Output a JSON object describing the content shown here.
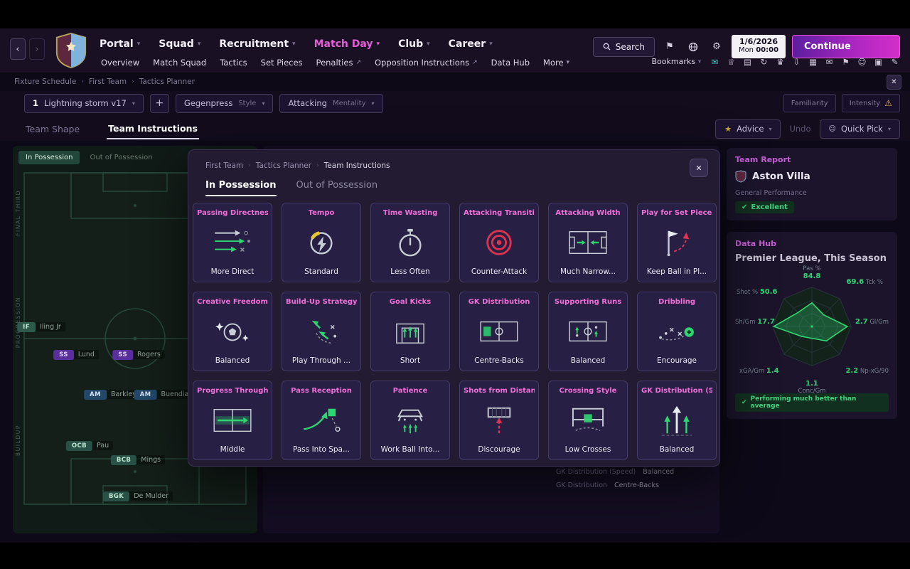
{
  "header": {
    "menus": [
      {
        "label": "Portal",
        "active": false
      },
      {
        "label": "Squad",
        "active": false
      },
      {
        "label": "Recruitment",
        "active": false
      },
      {
        "label": "Match Day",
        "active": true
      },
      {
        "label": "Club",
        "active": false
      },
      {
        "label": "Career",
        "active": false
      }
    ],
    "search_label": "Search",
    "date": "1/6/2026",
    "day": "Mon",
    "time": "00:00",
    "continue_label": "Continue",
    "subnav": [
      {
        "label": "Overview",
        "external": false
      },
      {
        "label": "Match Squad",
        "external": false
      },
      {
        "label": "Tactics",
        "external": false
      },
      {
        "label": "Set Pieces",
        "external": false
      },
      {
        "label": "Penalties",
        "external": true
      },
      {
        "label": "Opposition Instructions",
        "external": true
      },
      {
        "label": "Data Hub",
        "external": false
      },
      {
        "label": "More",
        "external": false,
        "chevron": true
      }
    ],
    "bookmarks_label": "Bookmarks",
    "quick_icons": [
      "messages",
      "club",
      "clipboard",
      "refresh",
      "trophy",
      "download",
      "reports",
      "mail",
      "flag",
      "squad",
      "calendar",
      "notes"
    ]
  },
  "breadcrumb": {
    "items": [
      "Fixture Schedule",
      "First Team",
      "Tactics Planner"
    ]
  },
  "toolbar": {
    "tactic_number": "1",
    "tactic_name": "Lightning storm v17",
    "add_label": "+",
    "style_value": "Gegenpress",
    "style_label": "Style",
    "mentality_value": "Attacking",
    "mentality_label": "Mentality",
    "familiarity_label": "Familiarity",
    "intensity_label": "Intensity"
  },
  "view_tabs": {
    "tabs": [
      {
        "label": "Team Shape",
        "active": false
      },
      {
        "label": "Team Instructions",
        "active": true
      }
    ],
    "advice_label": "Advice",
    "undo_label": "Undo",
    "quick_pick_label": "Quick Pick"
  },
  "pitch": {
    "tabs": [
      {
        "label": "In Possession",
        "active": true
      },
      {
        "label": "Out of Possession",
        "active": false
      }
    ],
    "zones": [
      "FINAL THIRD",
      "PROGRESSION",
      "BUILDUP"
    ],
    "players": [
      {
        "pos": "IF",
        "name": "Iling Jr"
      },
      {
        "pos": "SS",
        "name": "Lund"
      },
      {
        "pos": "SS",
        "name": "Rogers"
      },
      {
        "pos": "AM",
        "name": "Barkley"
      },
      {
        "pos": "AM",
        "name": "Buendia"
      },
      {
        "pos": "OCB",
        "name": "Pau"
      },
      {
        "pos": "BCB",
        "name": "Mings"
      },
      {
        "pos": "BGK",
        "name": "De Mulder"
      }
    ]
  },
  "modal": {
    "breadcrumb": [
      "First Team",
      "Tactics Planner",
      "Team Instructions"
    ],
    "tabs": [
      {
        "label": "In Possession",
        "active": true
      },
      {
        "label": "Out of Possession",
        "active": false
      }
    ],
    "cards": [
      {
        "title": "Passing Directness",
        "value": "More Direct",
        "icon": "passing-directness"
      },
      {
        "title": "Tempo",
        "value": "Standard",
        "icon": "tempo"
      },
      {
        "title": "Time Wasting",
        "value": "Less Often",
        "icon": "time-wasting"
      },
      {
        "title": "Attacking Transition",
        "value": "Counter-Attack",
        "icon": "attacking-transition"
      },
      {
        "title": "Attacking Width",
        "value": "Much Narrow...",
        "icon": "attacking-width"
      },
      {
        "title": "Play for Set Pieces",
        "value": "Keep Ball in Pl...",
        "icon": "set-pieces"
      },
      {
        "title": "Creative Freedom",
        "value": "Balanced",
        "icon": "creative-freedom"
      },
      {
        "title": "Build-Up Strategy",
        "value": "Play Through ...",
        "icon": "build-up"
      },
      {
        "title": "Goal Kicks",
        "value": "Short",
        "icon": "goal-kicks"
      },
      {
        "title": "GK Distribution",
        "value": "Centre-Backs",
        "icon": "gk-distribution"
      },
      {
        "title": "Supporting Runs",
        "value": "Balanced",
        "icon": "supporting-runs"
      },
      {
        "title": "Dribbling",
        "value": "Encourage",
        "icon": "dribbling"
      },
      {
        "title": "Progress Through",
        "value": "Middle",
        "icon": "progress-through"
      },
      {
        "title": "Pass Reception",
        "value": "Pass Into Spa...",
        "icon": "pass-reception"
      },
      {
        "title": "Patience",
        "value": "Work Ball Into...",
        "icon": "patience"
      },
      {
        "title": "Shots from Distance",
        "value": "Discourage",
        "icon": "shots-distance"
      },
      {
        "title": "Crossing Style",
        "value": "Low Crosses",
        "icon": "crossing-style"
      },
      {
        "title": "GK Distribution (Speed",
        "value": "Balanced",
        "icon": "gk-distribution-speed"
      }
    ]
  },
  "sidebar": {
    "team_report": {
      "title": "Team Report",
      "team": "Aston Villa",
      "subtitle": "General Performance",
      "rating": "Excellent"
    },
    "data_hub": {
      "title": "Data Hub",
      "subtitle": "Premier League, This Season",
      "badge": "Performing much better than average",
      "radar": {
        "axes": [
          "Pas %",
          "Tck %",
          "Gl/Gm",
          "Np-xG/90",
          "Conc/Gm",
          "xGA/Gm",
          "Sh/Gm",
          "Shot %"
        ],
        "values": [
          "84.8",
          "69.6",
          "2.7",
          "2.2",
          "1.1",
          "1.4",
          "17.7",
          "50.6"
        ],
        "normalized": [
          0.6,
          0.42,
          0.9,
          0.52,
          0.3,
          0.36,
          0.97,
          0.5
        ]
      }
    },
    "behind_rows": [
      {
        "label": "GK Distribution (Speed)",
        "value": "Balanced"
      },
      {
        "label": "GK Distribution",
        "value": "Centre-Backs"
      }
    ]
  },
  "colors": {
    "accent_magenta": "#e05fd6",
    "accent_green": "#2fd571",
    "accent_red": "#dd3350",
    "warning": "#f0b53c"
  }
}
